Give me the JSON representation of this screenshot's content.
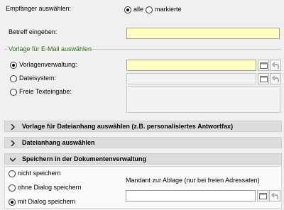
{
  "recipients": {
    "label": "Empfänger auswählen:",
    "options": [
      "alle",
      "markierte"
    ],
    "selected": "alle"
  },
  "subject": {
    "label": "Betreff eingeben:",
    "value": ""
  },
  "template_group": {
    "title": "Vorlage für E-Mail auswählen",
    "options": [
      "Vorlagenverwaltung:",
      "Dateisystem:",
      "Freie Texteingabe:"
    ],
    "selected": "Vorlagenverwaltung:"
  },
  "sections": [
    {
      "title": "Vorlage für Dateianhang auswählen (z.B. personalisiertes Antwortfax)",
      "expanded": false
    },
    {
      "title": "Dateianhang auswählen",
      "expanded": false
    },
    {
      "title": "Speichern in der Dokumentenverwaltung",
      "expanded": true
    }
  ],
  "save": {
    "options": [
      "nicht speichern",
      "ohne Dialog speichern",
      "mit Dialog speichern"
    ],
    "selected": "mit Dialog speichern",
    "mandant_label": "Mandant zur Ablage (nur  bei freien Adressaten)"
  },
  "colors": {
    "required_field": "#ffffc0",
    "group_title": "#2a6f1a",
    "section_bar": "#dcdcdc"
  },
  "icons": [
    "browse-icon",
    "undo-icon",
    "chevron-right-icon",
    "chevron-down-icon"
  ]
}
